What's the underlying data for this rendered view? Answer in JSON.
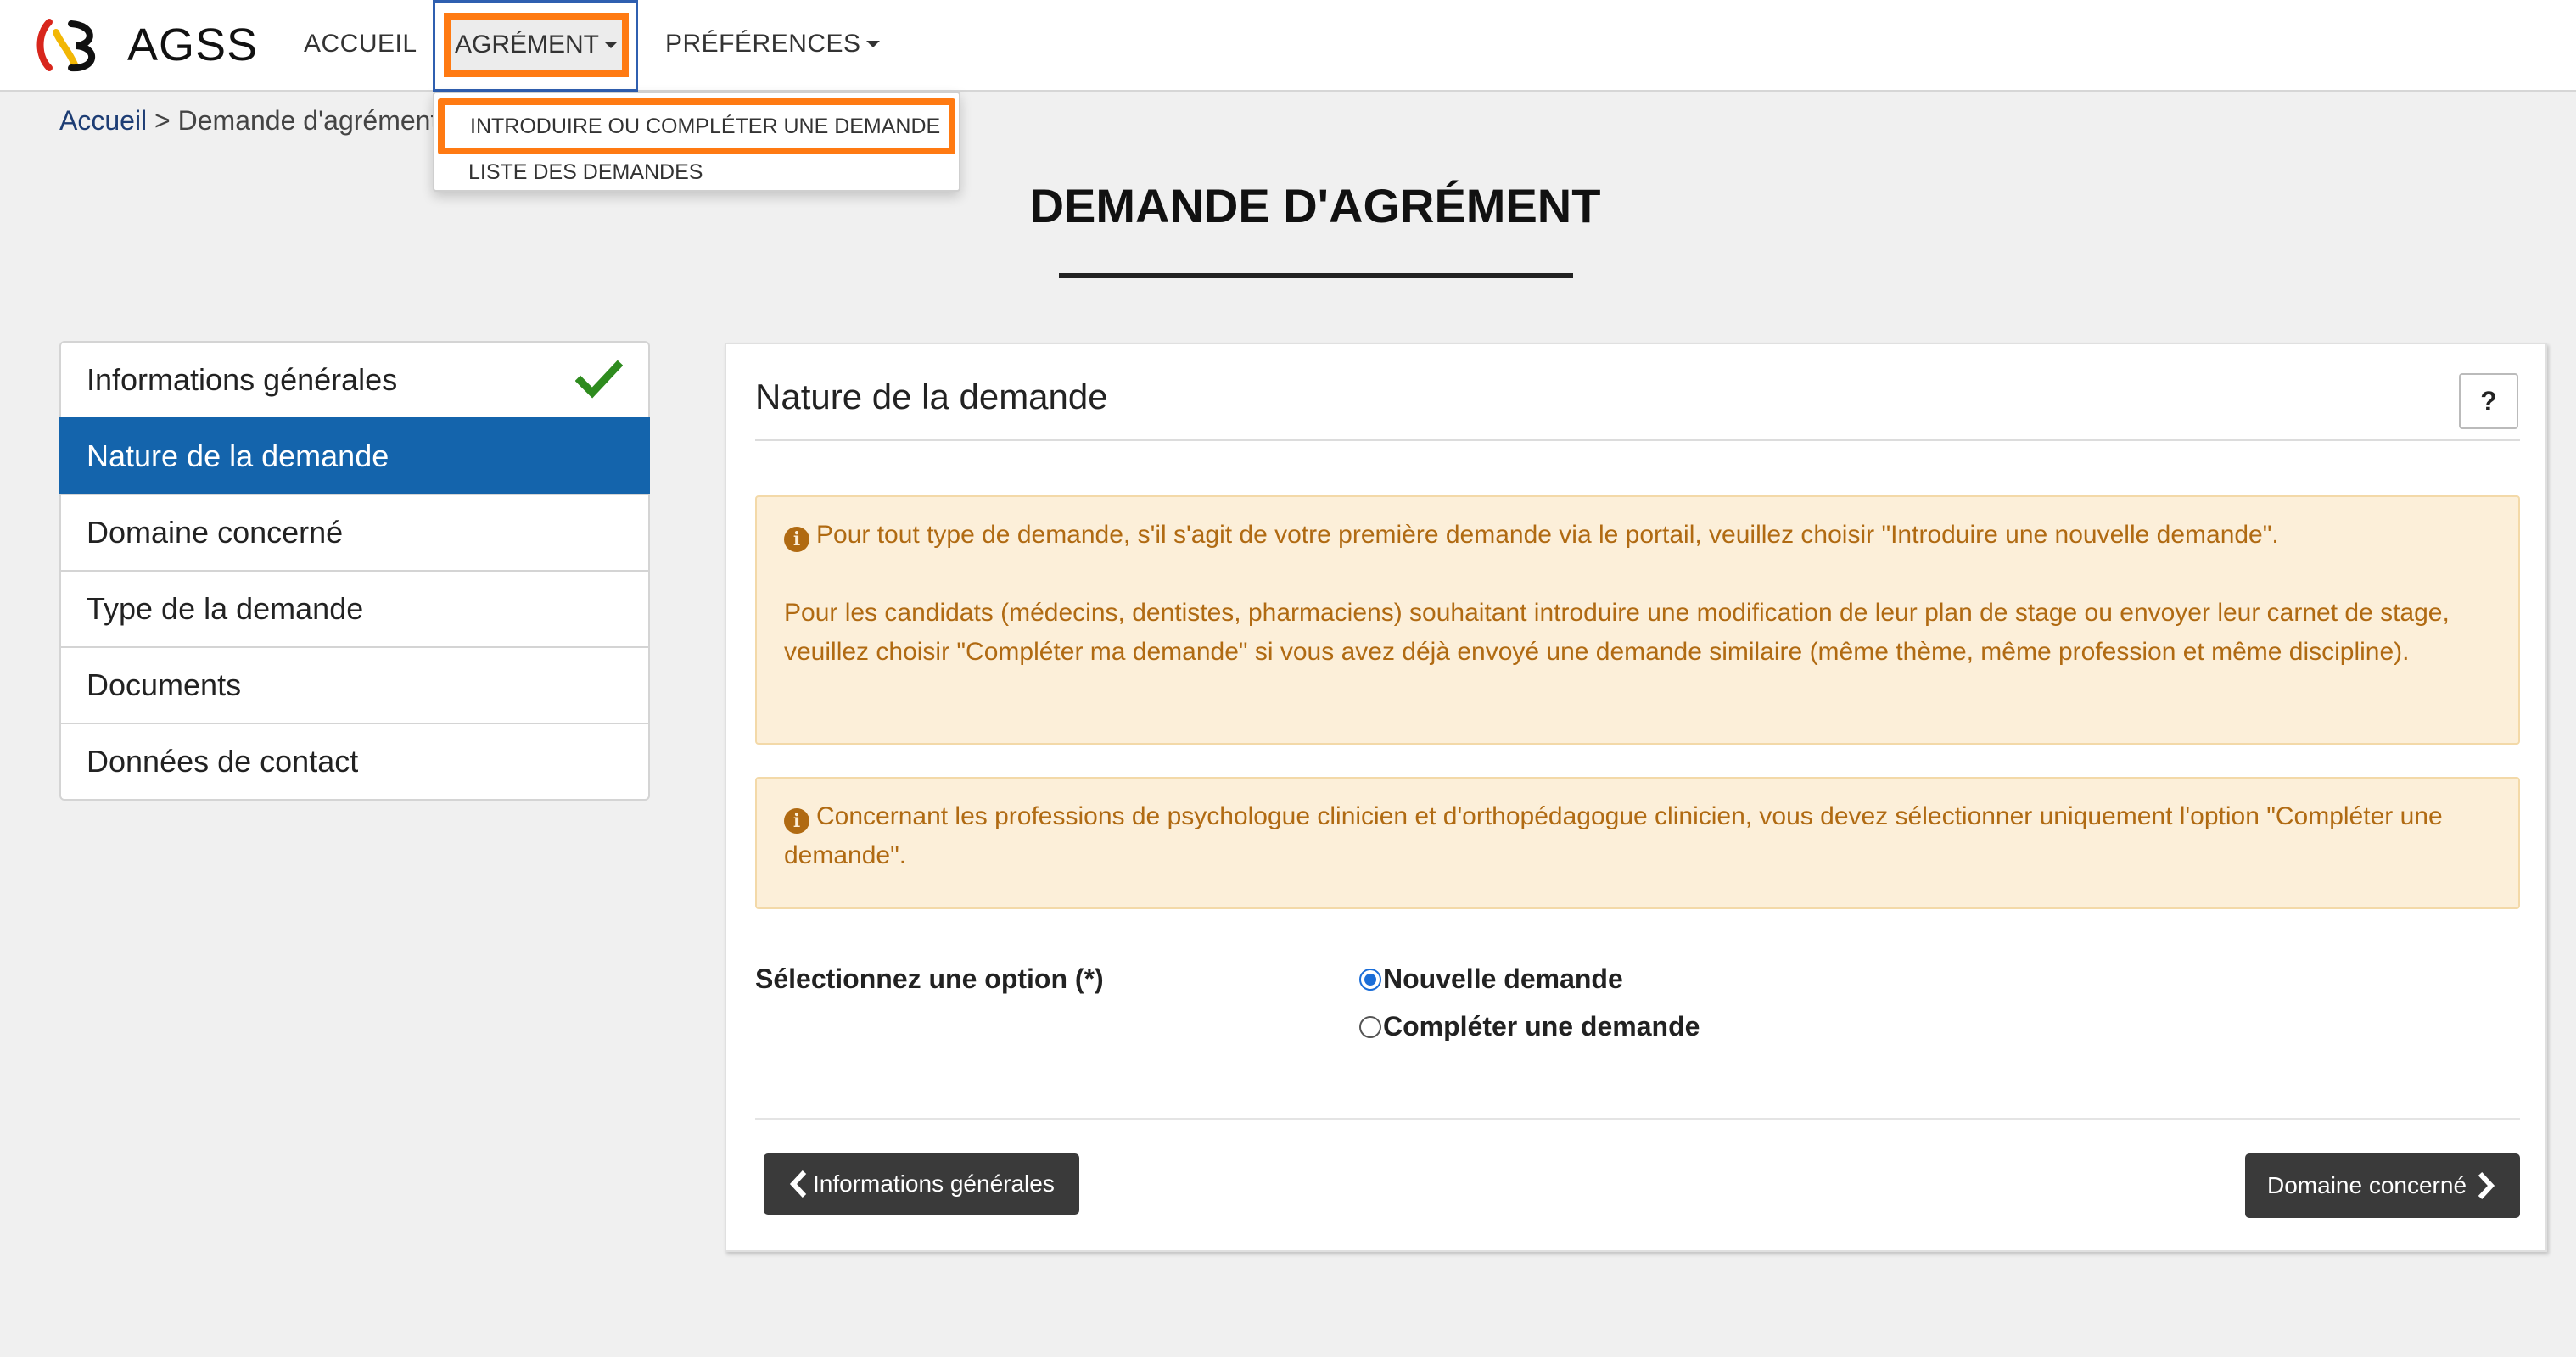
{
  "header": {
    "brand": "AGSS",
    "nav": {
      "accueil": "ACCUEIL",
      "agrement": "AGRÉMENT",
      "preferences": "PRÉFÉRENCES"
    }
  },
  "dropdown": {
    "items": [
      "INTRODUIRE OU COMPLÉTER UNE DEMANDE",
      "LISTE DES DEMANDES"
    ]
  },
  "breadcrumb": {
    "home": "Accueil",
    "separator": " > ",
    "current": "Demande d'agrément"
  },
  "page": {
    "title": "DEMANDE D'AGRÉMENT"
  },
  "steps": [
    {
      "label": "Informations générales",
      "completed": true
    },
    {
      "label": "Nature de la demande",
      "active": true
    },
    {
      "label": "Domaine concerné"
    },
    {
      "label": "Type de la demande"
    },
    {
      "label": "Documents"
    },
    {
      "label": "Données de contact"
    }
  ],
  "panel": {
    "title": "Nature de la demande",
    "help_label": "?",
    "alert1_p1": "Pour tout type de demande, s'il s'agit de votre première demande via le portail, veuillez choisir \"Introduire une nouvelle demande\".",
    "alert1_p2": "Pour les candidats (médecins, dentistes, pharmaciens) souhaitant introduire une modification de leur plan de stage ou envoyer leur carnet de stage, veuillez choisir \"Compléter ma demande\" si vous avez déjà envoyé une demande similaire (même thème, même profession et même discipline).",
    "alert2": "Concernant les professions de psychologue clinicien et d'orthopédagogue clinicien, vous devez sélectionner uniquement l'option \"Compléter une demande\".",
    "option_label": "Sélectionnez une option (*)",
    "options": [
      {
        "label": "Nouvelle demande",
        "selected": true
      },
      {
        "label": "Compléter une demande",
        "selected": false
      }
    ],
    "prev_button": "Informations générales",
    "next_button": "Domaine concerné"
  },
  "colors": {
    "active_step": "#1464ac",
    "highlight": "#ff7a12",
    "alert_bg": "#fcefd9",
    "alert_text": "#b06a12",
    "check": "#2e8b1e"
  },
  "icons": {
    "logo": "agss-logo-icon",
    "check": "check-icon",
    "info": "info-circle-icon",
    "prev": "chevron-left-icon",
    "next": "chevron-right-icon"
  }
}
